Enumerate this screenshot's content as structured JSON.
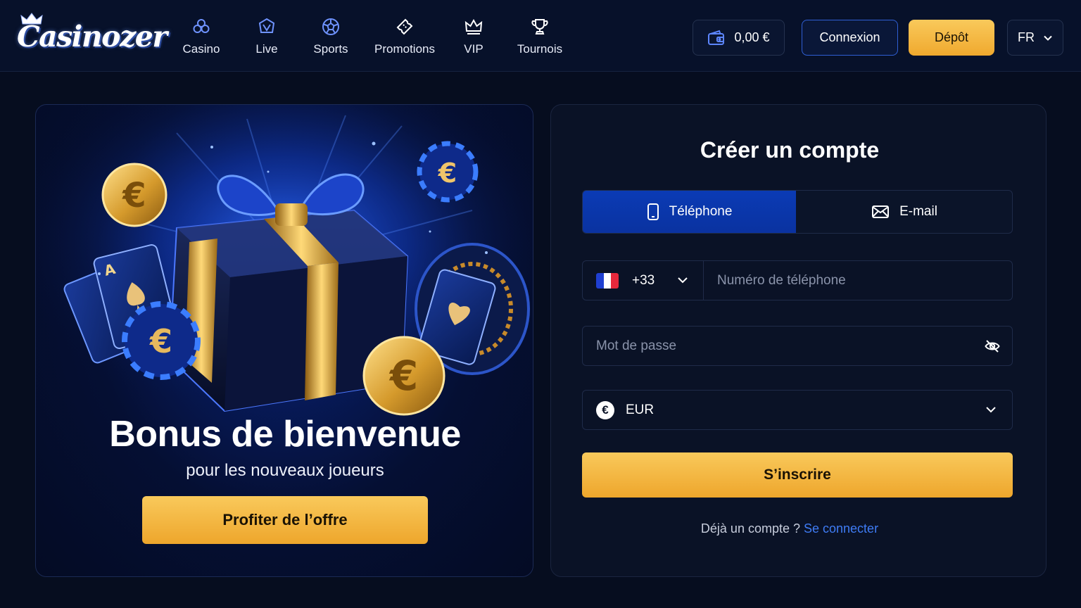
{
  "header": {
    "logo_text": "Casinozer",
    "nav": [
      {
        "label": "Casino",
        "icon": "casino-chip-icon"
      },
      {
        "label": "Live",
        "icon": "live-icon"
      },
      {
        "label": "Sports",
        "icon": "soccer-ball-icon"
      },
      {
        "label": "Promotions",
        "icon": "ticket-icon"
      },
      {
        "label": "VIP",
        "icon": "crown-icon"
      },
      {
        "label": "Tournois",
        "icon": "trophy-icon"
      }
    ],
    "balance": "0,00 €",
    "login_label": "Connexion",
    "deposit_label": "Dépôt",
    "language": "FR"
  },
  "promo": {
    "title": "Bonus de bienvenue",
    "subtitle": "pour les nouveaux joueurs",
    "cta_label": "Profiter de l’offre"
  },
  "signup": {
    "title": "Créer un compte",
    "tabs": [
      {
        "label": "Téléphone",
        "icon": "phone-icon",
        "active": true
      },
      {
        "label": "E-mail",
        "icon": "mail-icon",
        "active": false
      }
    ],
    "country_code": "+33",
    "phone_placeholder": "Numéro de téléphone",
    "password_placeholder": "Mot de passe",
    "currency_symbol": "€",
    "currency": "EUR",
    "submit_label": "S’inscrire",
    "login_prompt": "Déjà un compte ? ",
    "login_link": "Se connecter"
  },
  "colors": {
    "background": "#060d1f",
    "accent_gold": "#f5b942",
    "accent_blue": "#0b3bb5",
    "link_blue": "#3f7cf5"
  }
}
